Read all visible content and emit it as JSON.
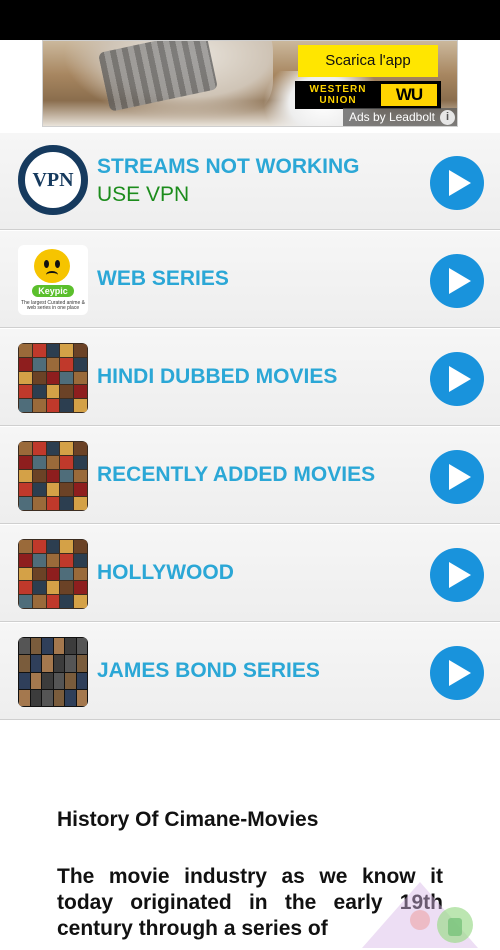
{
  "ad": {
    "cta_label": "Scarica l'app",
    "brand_text": "WESTERN UNION",
    "brand_logo": "WU",
    "ads_by_label": "Ads by Leadbolt",
    "info_icon": "i"
  },
  "list": {
    "items": [
      {
        "title": "STREAMS NOT WORKING",
        "subtitle": "USE VPN",
        "thumb_text": "VPN",
        "thumb": "vpn"
      },
      {
        "title": "WEB SERIES",
        "thumb_brand": "Keypic",
        "thumb_tagline": "The largest Curated anime & web series in one place",
        "thumb": "web"
      },
      {
        "title": "HINDI DUBBED MOVIES",
        "thumb": "grid"
      },
      {
        "title": "RECENTLY ADDED MOVIES",
        "thumb": "grid"
      },
      {
        "title": "HOLLYWOOD",
        "thumb": "grid"
      },
      {
        "title": "JAMES BOND SERIES",
        "thumb": "bond"
      }
    ]
  },
  "history": {
    "title": "History Of Cimane-Movies",
    "body": "The movie industry as we know it today originated in the early 19th century through a series of"
  },
  "colors": {
    "title": "#2ba7d6",
    "subtitle": "#1c8c1c",
    "play": "#1993dc",
    "ad_cta": "#ffe600"
  },
  "icons": [
    "play-icon",
    "info-icon",
    "vpn-logo",
    "watermark-icon"
  ]
}
